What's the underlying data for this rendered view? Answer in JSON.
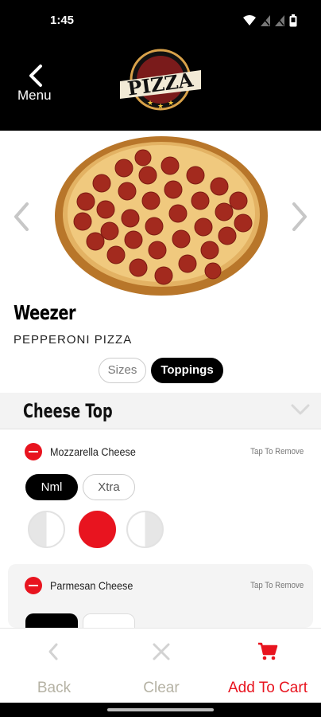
{
  "status_bar": {
    "time": "1:45"
  },
  "header": {
    "menu_label": "Menu",
    "logo_text": "PIZZA"
  },
  "item": {
    "name": "Weezer",
    "subtitle": "PEPPERONI PIZZA"
  },
  "segments": {
    "sizes": "Sizes",
    "toppings": "Toppings",
    "selected": "Toppings"
  },
  "section": {
    "title": "Cheese Top"
  },
  "toppings": [
    {
      "name": "Mozzarella Cheese",
      "tap_label": "Tap To Remove",
      "amount_options": [
        "Nml",
        "Xtra"
      ],
      "selected_amount": "Nml",
      "selected_portion": "whole"
    },
    {
      "name": "Parmesan Cheese",
      "tap_label": "Tap To Remove"
    }
  ],
  "bottom": {
    "back": "Back",
    "clear": "Clear",
    "add_to_cart": "Add To Cart"
  },
  "colors": {
    "accent": "#e8141f",
    "header_bg": "#000000",
    "muted": "#b5b2a4"
  }
}
